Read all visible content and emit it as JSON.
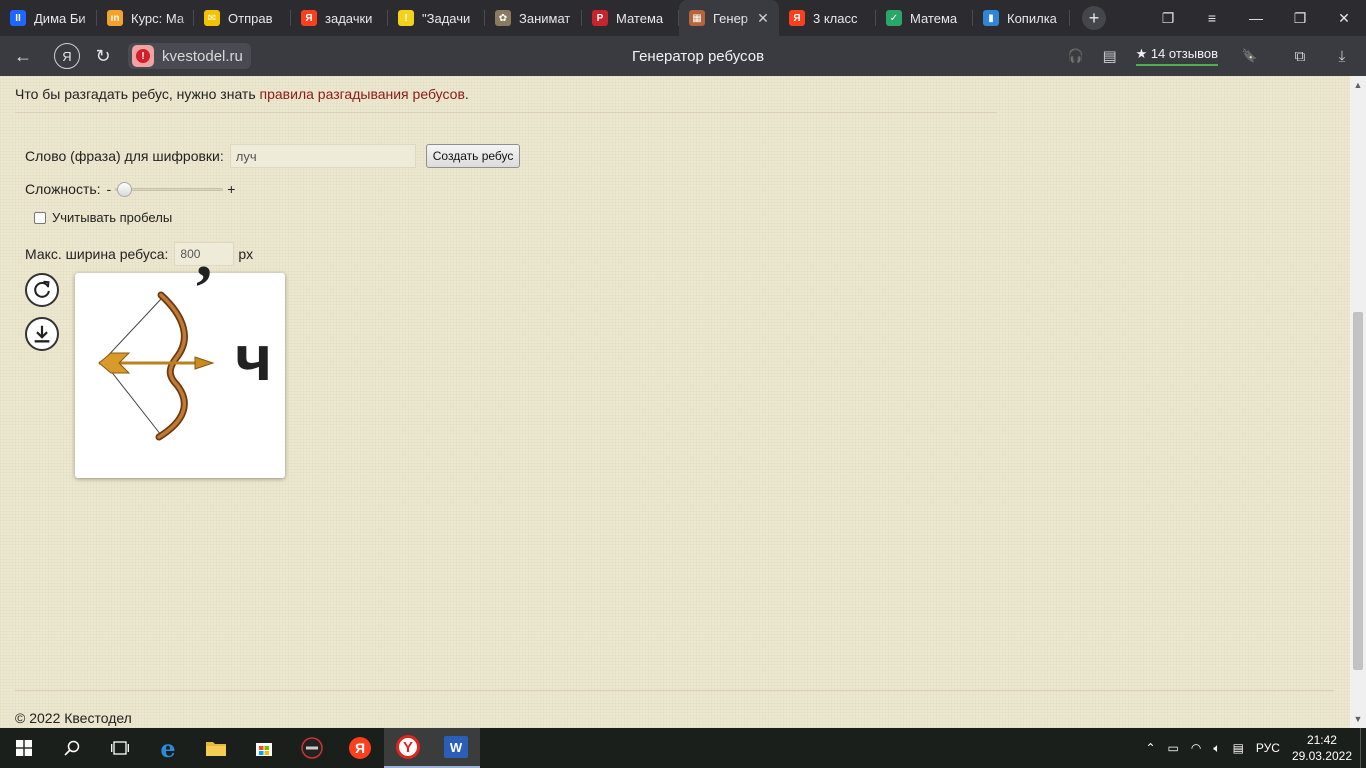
{
  "browser": {
    "tabs": [
      {
        "title": "Дима Би",
        "favicon_color": "#1e66ff",
        "favicon_glyph": "II",
        "active": false
      },
      {
        "title": "Курс: Ма",
        "favicon_color": "#f6a12b",
        "favicon_glyph": "ın",
        "active": false
      },
      {
        "title": "Отправ",
        "favicon_color": "#f2c300",
        "favicon_glyph": "✉",
        "active": false
      },
      {
        "title": "задачки",
        "favicon_color": "#fc3f1d",
        "favicon_glyph": "Я",
        "active": false
      },
      {
        "title": "\"Задачи",
        "favicon_color": "#f2d21b",
        "favicon_glyph": "!",
        "active": false
      },
      {
        "title": "Занимат",
        "favicon_color": "#8a7a60",
        "favicon_glyph": "✿",
        "active": false
      },
      {
        "title": "Матема",
        "favicon_color": "#c9242b",
        "favicon_glyph": "P",
        "active": false
      },
      {
        "title": "Генер",
        "favicon_color": "#b5653a",
        "favicon_glyph": "▦",
        "active": true
      },
      {
        "title": "3 класс",
        "favicon_color": "#fc3f1d",
        "favicon_glyph": "Я",
        "active": false
      },
      {
        "title": "Матема",
        "favicon_color": "#2aa66b",
        "favicon_glyph": "✓",
        "active": false
      },
      {
        "title": "Копилка",
        "favicon_color": "#2f86d6",
        "favicon_glyph": "▮",
        "active": false
      }
    ],
    "tab_close_glyph": "✕",
    "new_tab_glyph": "+",
    "window_controls": {
      "collections": "❐",
      "menu": "≡",
      "minimize": "—",
      "restore": "❐",
      "close": "✕"
    },
    "address": {
      "domain": "kvestodel.ru",
      "page_title": "Генератор ребусов",
      "reviews": "★ 14 отзывов"
    },
    "toolbar_icons": {
      "back": "←",
      "yandex": "Я",
      "reload": "↻",
      "headphones": "🎧",
      "reader": "▤",
      "bookmark": "🔖",
      "extensions": "⧉",
      "download": "⤓"
    }
  },
  "page": {
    "intro_text": "Что бы разгадать ребус, нужно знать",
    "intro_link": "правила разгадывания ребусов",
    "intro_end": ".",
    "word_label": "Слово (фраза) для шифровки:",
    "word_value": "луч",
    "create_button": "Создать ребус",
    "difficulty_label": "Сложность:",
    "difficulty_minus": "-",
    "difficulty_plus": "+",
    "difficulty_level": 0.08,
    "spaces_label": "Учитывать пробелы",
    "spaces_checked": false,
    "width_label": "Макс. ширина ребуса:",
    "width_value": "800",
    "width_unit": "px",
    "rebus": {
      "image": "bow-and-arrow",
      "comma": "’",
      "letter": "ч"
    },
    "footer": "© 2022 Квестодел"
  },
  "taskbar": {
    "tray_lang": "РУС",
    "time": "21:42",
    "date": "29.03.2022"
  }
}
